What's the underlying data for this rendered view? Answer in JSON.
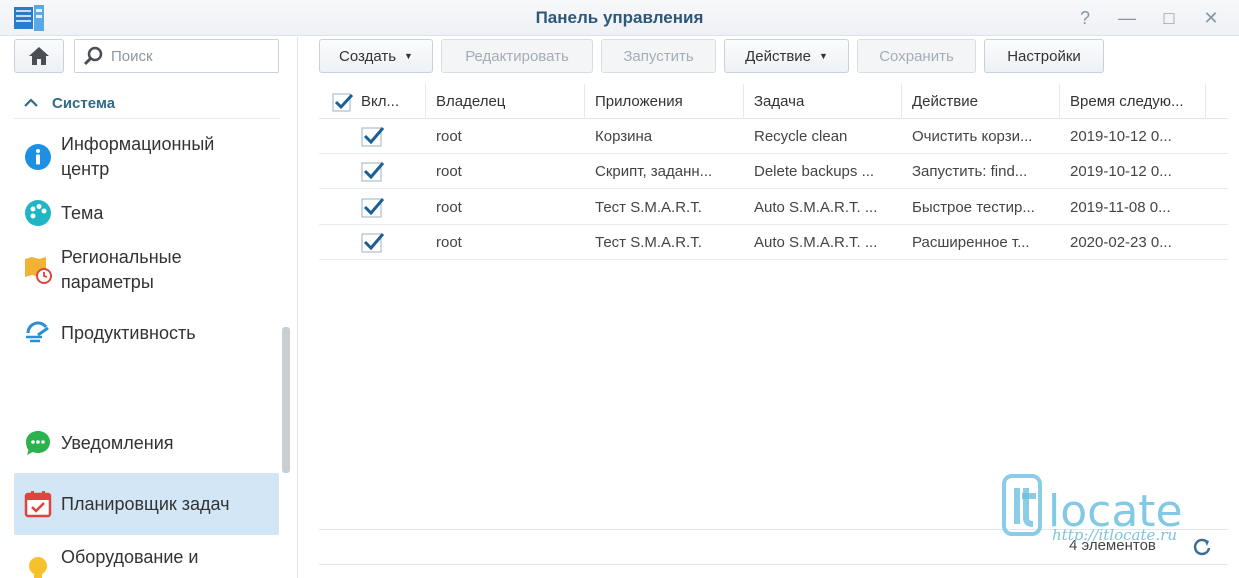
{
  "window": {
    "title": "Панель управления",
    "controls": [
      "?",
      "—",
      "□",
      "✕"
    ]
  },
  "sidebar": {
    "search_placeholder": "Поиск",
    "section": "Система",
    "items": [
      {
        "label": "Информационный центр",
        "icon": "info-icon"
      },
      {
        "label": "Тема",
        "icon": "palette-icon"
      },
      {
        "label": "Региональные параметры",
        "icon": "map-clock-icon"
      },
      {
        "label": "Продуктивность",
        "icon": "speed-icon"
      },
      {
        "label": "Уведомления",
        "icon": "chat-bubble-icon"
      },
      {
        "label": "Планировщик задач",
        "icon": "calendar-check-icon",
        "active": true
      },
      {
        "label": "Оборудование и питание",
        "icon": "bulb-icon"
      }
    ]
  },
  "toolbar": {
    "create": "Создать",
    "edit": "Редактировать",
    "run": "Запустить",
    "action": "Действие",
    "save": "Сохранить",
    "settings": "Настройки"
  },
  "table": {
    "columns": [
      "Вкл...",
      "Владелец",
      "Приложения",
      "Задача",
      "Действие",
      "Время следую..."
    ],
    "rows": [
      {
        "enabled": true,
        "owner": "root",
        "app": "Корзина",
        "task": "Recycle clean",
        "action": "Очистить корзи...",
        "next": "2019-10-12 0..."
      },
      {
        "enabled": true,
        "owner": "root",
        "app": "Скрипт, заданн...",
        "task": "Delete backups ...",
        "action": "Запустить: find...",
        "next": "2019-10-12 0..."
      },
      {
        "enabled": true,
        "owner": "root",
        "app": "Тест S.M.A.R.T.",
        "task": "Auto S.M.A.R.T. ...",
        "action": "Быстрое тестир...",
        "next": "2019-11-08 0..."
      },
      {
        "enabled": true,
        "owner": "root",
        "app": "Тест S.M.A.R.T.",
        "task": "Auto S.M.A.R.T. ...",
        "action": "Расширенное т...",
        "next": "2020-02-23 0..."
      }
    ]
  },
  "footer": {
    "count": "4 элементов"
  },
  "watermark": {
    "logo": "itlocate",
    "url": "http://itlocate.ru"
  },
  "colors": {
    "accent": "#1a6ea8",
    "title": "#2d5879",
    "active_bg": "#d2e6f6",
    "check": "#1c5f93"
  }
}
